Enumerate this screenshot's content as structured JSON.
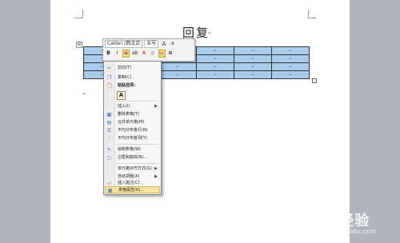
{
  "document": {
    "title": "回复",
    "para_mark": "↵",
    "cell_mark": "↵",
    "move_handle": "⊕"
  },
  "mini_toolbar": {
    "font_name": "Calibri (西文正",
    "font_size": "五号",
    "grow_font": "A",
    "shrink_font": "A",
    "bold": "B",
    "italic": "I",
    "align_center": "≡",
    "highlight": "ab",
    "font_color": "A",
    "eraser": "◇",
    "fill": "▭",
    "borders": "⊞"
  },
  "context_menu": {
    "items": [
      {
        "label": "剪切(T)",
        "icon": "scissors-icon",
        "glyph": "✂"
      },
      {
        "label": "复制(C)",
        "icon": "copy-icon",
        "glyph": "❐"
      },
      {
        "label": "粘贴选项:",
        "icon": "paste-icon",
        "glyph": "📋"
      },
      {
        "label": "插入(I)",
        "icon": "",
        "glyph": ""
      },
      {
        "label": "删除表格(T)",
        "icon": "delete-table-icon",
        "glyph": "▦"
      },
      {
        "label": "合并单元格(M)",
        "icon": "merge-cells-icon",
        "glyph": "▤"
      },
      {
        "label": "平均分布各行(N)",
        "icon": "distribute-rows-icon",
        "glyph": "☰"
      },
      {
        "label": "平均分布各列(Y)",
        "icon": "distribute-columns-icon",
        "glyph": "⋮"
      },
      {
        "label": "绘制表格(W)",
        "icon": "draw-table-icon",
        "glyph": "✎"
      },
      {
        "label": "边框和底纹(B)...",
        "icon": "borders-shading-icon",
        "glyph": "▢"
      },
      {
        "label": "单元格对齐方式(G)",
        "icon": "",
        "glyph": ""
      },
      {
        "label": "自动调整(A)",
        "icon": "",
        "glyph": ""
      },
      {
        "label": "插入题注(C)...",
        "icon": "caption-icon",
        "glyph": "▭"
      },
      {
        "label": "表格属性(R)...",
        "icon": "table-properties-icon",
        "glyph": "▦"
      }
    ],
    "paste_option_glyph": "A"
  },
  "watermark": {
    "text": "Bai 经验",
    "sub": "jingyan.baidu.com"
  },
  "colors": {
    "selection": "#a9cbec",
    "menu_highlight": "#fbe3a3",
    "background": "#b0b5bb"
  }
}
